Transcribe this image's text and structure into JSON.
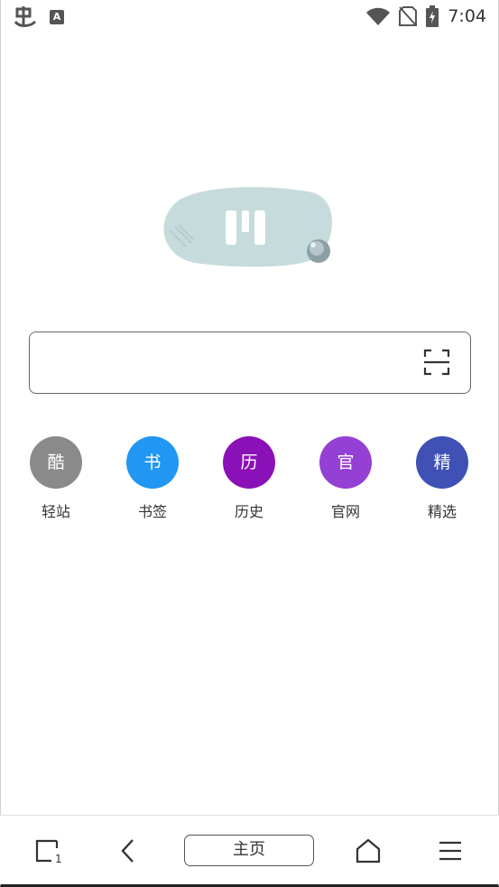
{
  "status_bar": {
    "time": "7:04",
    "left_icons": [
      "app-notification-icon",
      "accessibility-a-icon"
    ],
    "a_icon_label": "A",
    "right_icons": [
      "wifi-icon",
      "no-sim-icon",
      "battery-charging-icon"
    ]
  },
  "search": {
    "value": "",
    "placeholder": ""
  },
  "shortcuts": [
    {
      "glyph": "酷",
      "label": "轻站",
      "color": "#8a8a8a"
    },
    {
      "glyph": "书",
      "label": "书签",
      "color": "#2196f3"
    },
    {
      "glyph": "历",
      "label": "历史",
      "color": "#8a10b8"
    },
    {
      "glyph": "官",
      "label": "官网",
      "color": "#9440d4"
    },
    {
      "glyph": "精",
      "label": "精选",
      "color": "#3f51b5"
    }
  ],
  "bottom_bar": {
    "home_label": "主页",
    "tabs_count": "1"
  }
}
